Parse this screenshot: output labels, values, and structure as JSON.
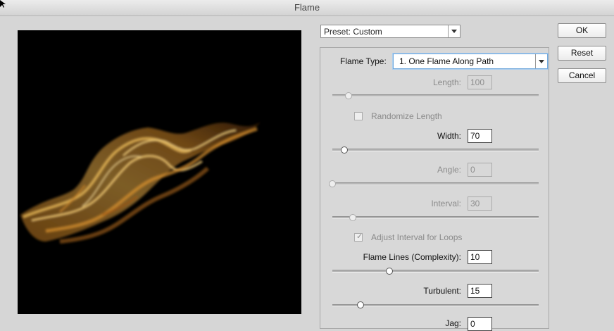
{
  "window": {
    "title": "Flame"
  },
  "preset": {
    "label": "Preset: Custom"
  },
  "buttons": {
    "ok": "OK",
    "reset": "Reset",
    "cancel": "Cancel"
  },
  "flame_type": {
    "label": "Flame Type:",
    "value": "1. One Flame Along Path"
  },
  "fields": {
    "length": {
      "label": "Length:",
      "value": "100",
      "enabled": false,
      "slider": 0.08
    },
    "width": {
      "label": "Width:",
      "value": "70",
      "enabled": true,
      "slider": 0.06
    },
    "angle": {
      "label": "Angle:",
      "value": "0",
      "enabled": false,
      "slider": 0.0
    },
    "interval": {
      "label": "Interval:",
      "value": "30",
      "enabled": false,
      "slider": 0.1
    },
    "flame_lines": {
      "label": "Flame Lines (Complexity):",
      "value": "10",
      "enabled": true,
      "slider": 0.28
    },
    "turbulent": {
      "label": "Turbulent:",
      "value": "15",
      "enabled": true,
      "slider": 0.14
    },
    "jag": {
      "label": "Jag:",
      "value": "0",
      "enabled": true
    }
  },
  "checks": {
    "randomize_length": {
      "label": "Randomize Length",
      "checked": false,
      "enabled": false
    },
    "adjust_interval": {
      "label": "Adjust Interval for Loops",
      "checked": true,
      "enabled": false
    }
  },
  "colors": {
    "flame_core": "#f2c260",
    "flame_edge": "#a85a12",
    "preview_bg": "#000000"
  }
}
